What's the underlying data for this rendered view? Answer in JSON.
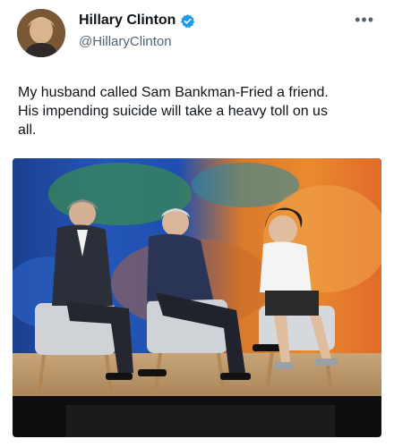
{
  "tweet": {
    "author_name": "Hillary Clinton",
    "author_handle": "@HillaryClinton",
    "text": "My husband called Sam Bankman-Fried a friend.\nHis impending suicide will take a heavy toll on us\nall.",
    "more_label": "•••"
  },
  "icons": {
    "verified": "verified-badge-icon",
    "more": "more-options-icon"
  },
  "colors": {
    "verified_blue": "#1d9bf0",
    "text": "#0f1419",
    "secondary_text": "#536471"
  }
}
